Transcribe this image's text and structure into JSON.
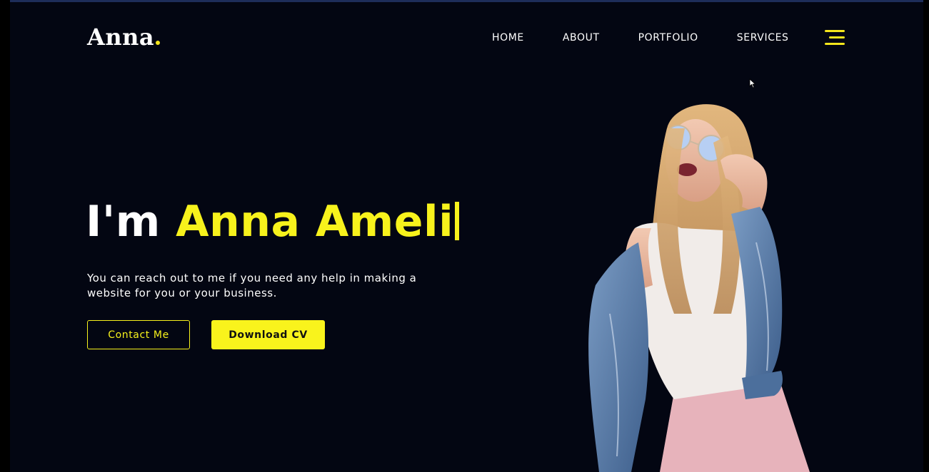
{
  "brand": {
    "logo_text": "Anna"
  },
  "nav": {
    "items": [
      {
        "label": "HOME"
      },
      {
        "label": "ABOUT"
      },
      {
        "label": "PORTFOLIO"
      },
      {
        "label": "SERVICES"
      }
    ],
    "menu_icon": "hamburger-menu-icon"
  },
  "hero": {
    "greeting": "I'm",
    "name": "Anna Ameli",
    "subtitle": "You can reach out to me if you need any help in making a website for you or your business.",
    "contact_label": "Contact Me",
    "download_label": "Download CV"
  },
  "colors": {
    "background": "#030612",
    "accent": "#f7f21c",
    "text": "#ffffff"
  }
}
